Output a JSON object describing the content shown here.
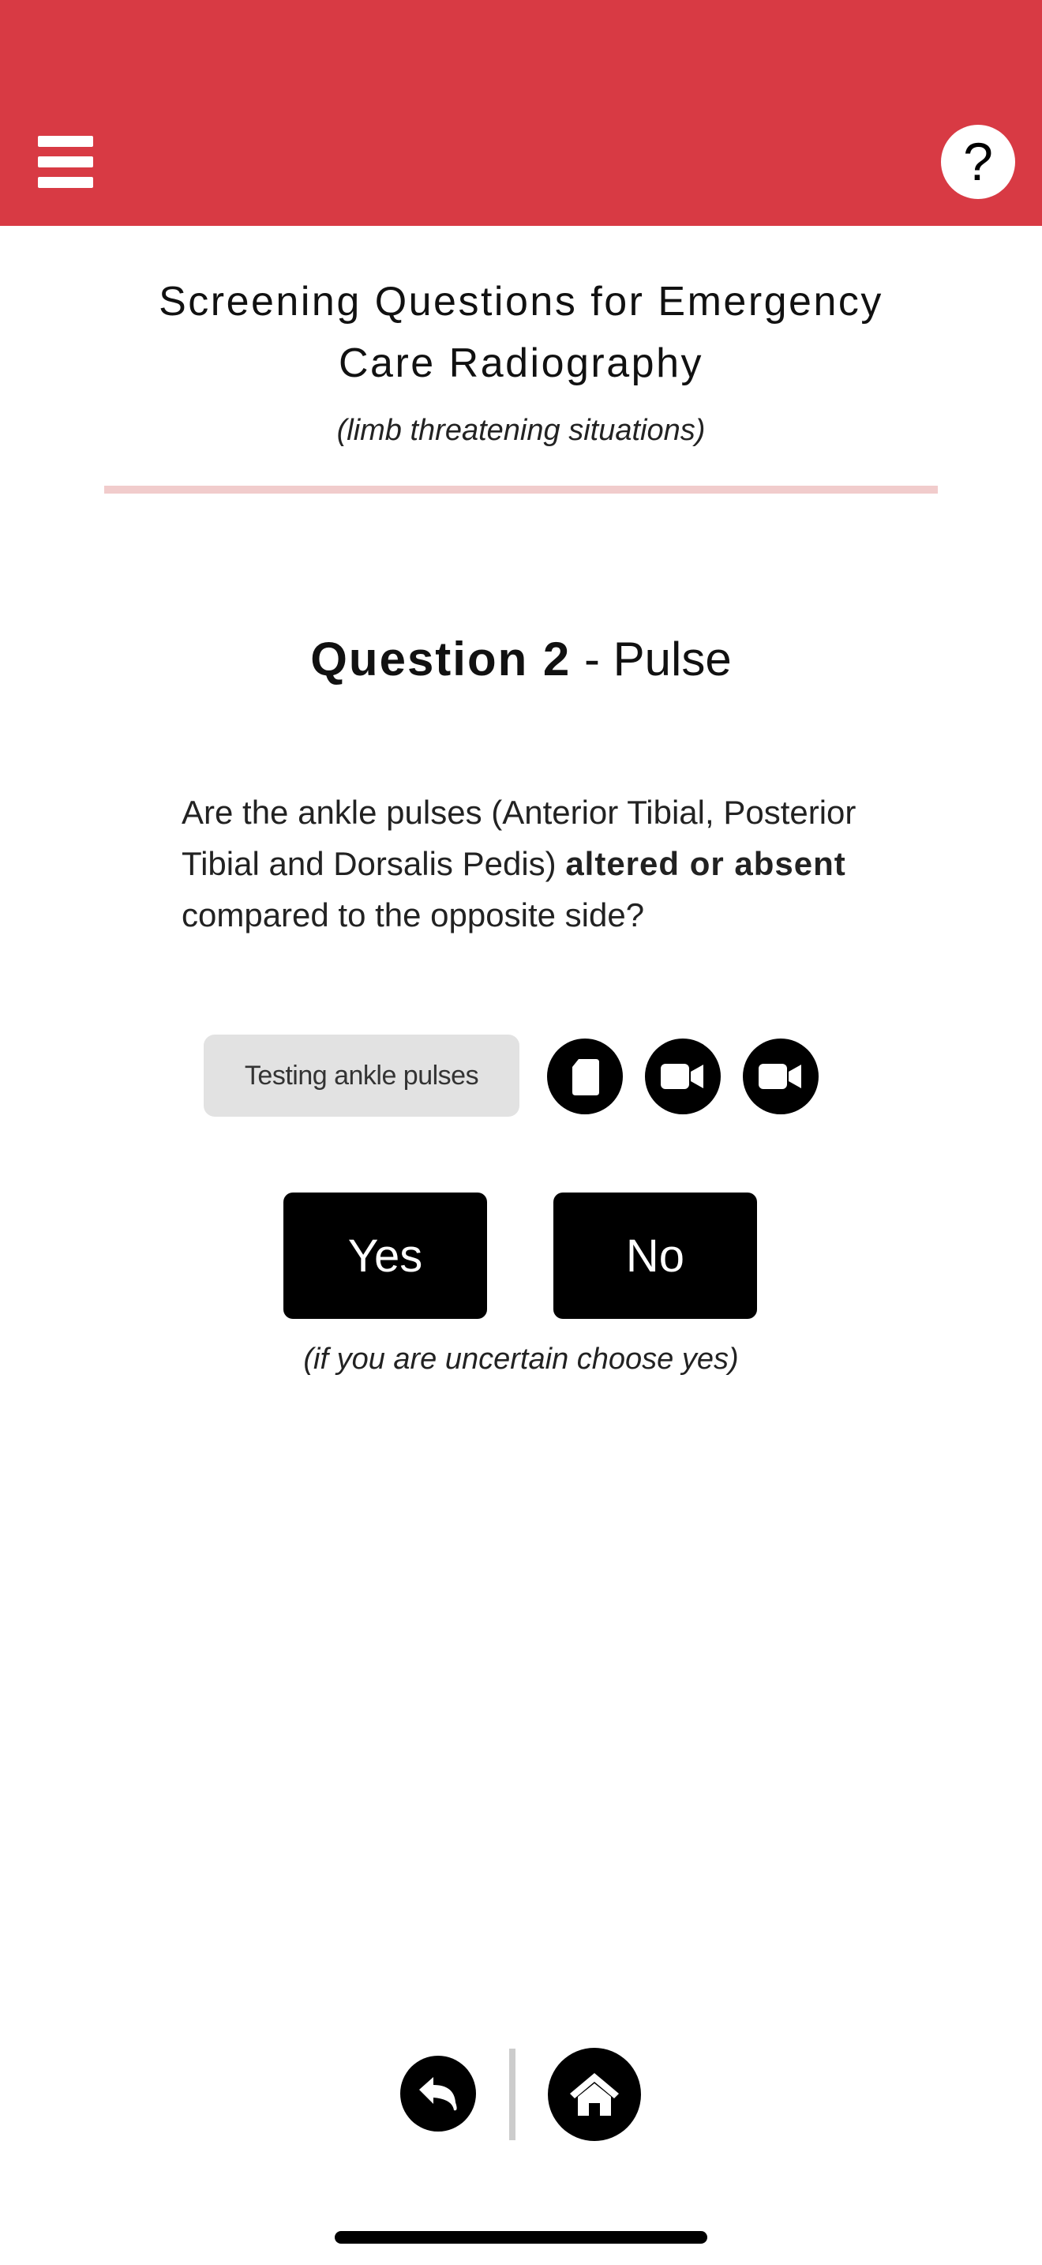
{
  "header": {
    "menu_icon": "hamburger-menu-icon",
    "help_label": "?",
    "background_color": "#d83a44"
  },
  "title": {
    "line1": "Screening Questions for Emergency",
    "line2": "Care Radiography",
    "subtitle": "(limb threatening situations)"
  },
  "question": {
    "number_label": "Question 2",
    "topic": " - Pulse",
    "text_before": "Are the ankle pulses (Anterior Tibial, Posterior Tibial and Dorsalis Pedis) ",
    "text_bold": "altered or absent",
    "text_after": " compared to the opposite side?"
  },
  "resources": {
    "button_label": "Testing ankle pulses",
    "icons": [
      "document-icon",
      "video-camera-icon",
      "video-camera-icon"
    ]
  },
  "answers": {
    "yes_label": "Yes",
    "no_label": "No",
    "hint": "(if you are uncertain choose yes)"
  },
  "bottom_nav": {
    "back_icon": "back-arrow-icon",
    "home_icon": "home-icon"
  }
}
